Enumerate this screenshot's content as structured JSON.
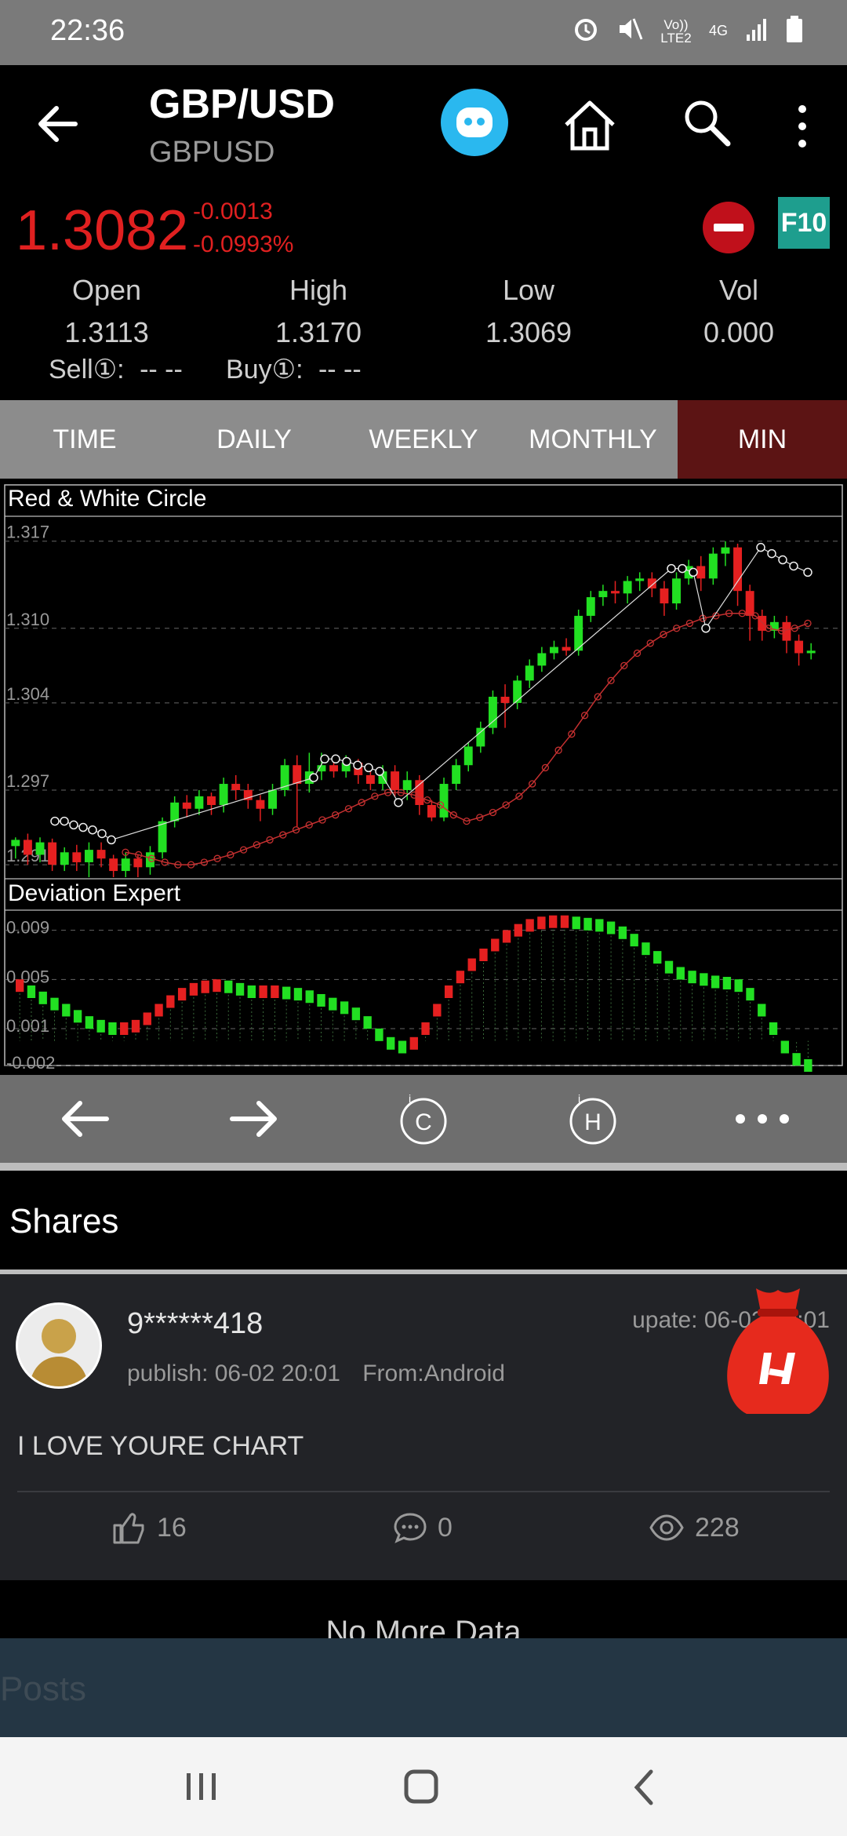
{
  "status_bar": {
    "time": "22:36",
    "network_label": "Vo)) LTE2",
    "network_type": "4G"
  },
  "header": {
    "title": "GBP/USD",
    "subtitle": "GBPUSD"
  },
  "quote": {
    "price": "1.3082",
    "change": "-0.0013",
    "change_pct": "-0.0993%",
    "f10_label": "F10",
    "stats": [
      {
        "label": "Open",
        "value": "1.3113"
      },
      {
        "label": "High",
        "value": "1.3170"
      },
      {
        "label": "Low",
        "value": "1.3069"
      },
      {
        "label": "Vol",
        "value": "0.000"
      }
    ],
    "sell_label": "Sell①:",
    "sell_value": "-- --",
    "buy_label": "Buy①:",
    "buy_value": "-- --"
  },
  "tabs": [
    {
      "label": "TIME"
    },
    {
      "label": "DAILY"
    },
    {
      "label": "WEEKLY"
    },
    {
      "label": "MONTHLY"
    },
    {
      "label": "MIN",
      "active": true
    }
  ],
  "chart_data": [
    {
      "type": "candlestick",
      "title": "Red & White Circle",
      "y_ticks": [
        "1.317",
        "1.310",
        "1.304",
        "1.297",
        "1.291"
      ],
      "ylim": [
        1.29,
        1.319
      ],
      "candles": [
        [
          1.2925,
          1.293,
          1.2915,
          1.2932
        ],
        [
          1.293,
          1.2918,
          1.291,
          1.2935
        ],
        [
          1.2918,
          1.2928,
          1.2912,
          1.2932
        ],
        [
          1.2928,
          1.291,
          1.2905,
          1.2931
        ],
        [
          1.291,
          1.292,
          1.2905,
          1.2924
        ],
        [
          1.292,
          1.2912,
          1.2905,
          1.2926
        ],
        [
          1.2912,
          1.2922,
          1.29,
          1.2928
        ],
        [
          1.2922,
          1.2915,
          1.2908,
          1.2928
        ],
        [
          1.2915,
          1.2905,
          1.29,
          1.2918
        ],
        [
          1.2905,
          1.2915,
          1.29,
          1.292
        ],
        [
          1.2915,
          1.2908,
          1.29,
          1.2918
        ],
        [
          1.2908,
          1.292,
          1.2902,
          1.2925
        ],
        [
          1.292,
          1.2945,
          1.2915,
          1.2948
        ],
        [
          1.2945,
          1.296,
          1.294,
          1.2965
        ],
        [
          1.296,
          1.2955,
          1.2948,
          1.2966
        ],
        [
          1.2955,
          1.2965,
          1.295,
          1.297
        ],
        [
          1.2965,
          1.2958,
          1.295,
          1.2968
        ],
        [
          1.2958,
          1.2975,
          1.2952,
          1.298
        ],
        [
          1.2975,
          1.297,
          1.2962,
          1.2982
        ],
        [
          1.297,
          1.2962,
          1.2955,
          1.2975
        ],
        [
          1.2962,
          1.2955,
          1.2945,
          1.2966
        ],
        [
          1.2955,
          1.297,
          1.295,
          1.2975
        ],
        [
          1.297,
          1.299,
          1.2965,
          1.2995
        ],
        [
          1.299,
          1.2975,
          1.294,
          1.2998
        ],
        [
          1.2975,
          1.2985,
          1.2968,
          1.3
        ],
        [
          1.2985,
          1.299,
          1.2978,
          1.3
        ],
        [
          1.299,
          1.2985,
          1.298,
          1.2995
        ],
        [
          1.2985,
          1.2992,
          1.298,
          1.2998
        ],
        [
          1.2992,
          1.2982,
          1.2975,
          1.2995
        ],
        [
          1.2982,
          1.2975,
          1.297,
          1.2988
        ],
        [
          1.2975,
          1.2985,
          1.297,
          1.299
        ],
        [
          1.2985,
          1.297,
          1.2965,
          1.299
        ],
        [
          1.297,
          1.2978,
          1.2962,
          1.2985
        ],
        [
          1.2978,
          1.2958,
          1.295,
          1.2982
        ],
        [
          1.2958,
          1.2948,
          1.2945,
          1.2962
        ],
        [
          1.2948,
          1.2975,
          1.2945,
          1.298
        ],
        [
          1.2975,
          1.299,
          1.297,
          1.2995
        ],
        [
          1.299,
          1.3005,
          1.2985,
          1.3008
        ],
        [
          1.3005,
          1.302,
          1.3,
          1.3025
        ],
        [
          1.302,
          1.3045,
          1.3015,
          1.305
        ],
        [
          1.3045,
          1.304,
          1.302,
          1.3055
        ],
        [
          1.304,
          1.3058,
          1.3035,
          1.3062
        ],
        [
          1.3058,
          1.307,
          1.3052,
          1.3075
        ],
        [
          1.307,
          1.308,
          1.3065,
          1.3085
        ],
        [
          1.308,
          1.3085,
          1.3075,
          1.309
        ],
        [
          1.3085,
          1.3082,
          1.3078,
          1.3092
        ],
        [
          1.3082,
          1.311,
          1.3078,
          1.3115
        ],
        [
          1.311,
          1.3125,
          1.3105,
          1.313
        ],
        [
          1.3125,
          1.313,
          1.3118,
          1.3135
        ],
        [
          1.313,
          1.3128,
          1.312,
          1.3138
        ],
        [
          1.3128,
          1.3138,
          1.312,
          1.3142
        ],
        [
          1.3138,
          1.314,
          1.313,
          1.3145
        ],
        [
          1.314,
          1.3132,
          1.3125,
          1.3145
        ],
        [
          1.3132,
          1.312,
          1.311,
          1.3138
        ],
        [
          1.312,
          1.314,
          1.3115,
          1.3145
        ],
        [
          1.314,
          1.315,
          1.3135,
          1.3155
        ],
        [
          1.315,
          1.314,
          1.313,
          1.3158
        ],
        [
          1.314,
          1.316,
          1.3135,
          1.3165
        ],
        [
          1.316,
          1.3165,
          1.315,
          1.317
        ],
        [
          1.3165,
          1.313,
          1.3118,
          1.3168
        ],
        [
          1.313,
          1.311,
          1.309,
          1.3135
        ],
        [
          1.311,
          1.3098,
          1.309,
          1.3115
        ],
        [
          1.3098,
          1.3105,
          1.3092,
          1.311
        ],
        [
          1.3105,
          1.309,
          1.308,
          1.311
        ],
        [
          1.309,
          1.308,
          1.307,
          1.3095
        ],
        [
          1.308,
          1.3082,
          1.3075,
          1.3088
        ]
      ],
      "series": [
        {
          "type": "circle-line",
          "color": "#cc3333",
          "values": [
            1.292,
            1.2918,
            1.2915,
            1.2912,
            1.291,
            1.291,
            1.2912,
            1.2915,
            1.2918,
            1.2922,
            1.2926,
            1.293,
            1.2934,
            1.2938,
            1.2942,
            1.2946,
            1.295,
            1.2955,
            1.296,
            1.2965,
            1.2968,
            1.2968,
            1.2966,
            1.2962,
            1.2958,
            1.295,
            1.2945,
            1.2948,
            1.2952,
            1.2958,
            1.2965,
            1.2975,
            1.2988,
            1.3002,
            1.3015,
            1.303,
            1.3045,
            1.3058,
            1.307,
            1.308,
            1.3088,
            1.3095,
            1.31,
            1.3104,
            1.3108,
            1.311,
            1.3112,
            1.3112,
            1.311,
            1.31,
            1.3098,
            1.31,
            1.3104
          ]
        },
        {
          "type": "white-circle",
          "color": "#ffffff",
          "values": [
            1.2945,
            1.2945,
            1.2942,
            1.294,
            1.2938,
            1.2935,
            1.293,
            1.298,
            1.2995,
            1.2995,
            1.2993,
            1.299,
            1.2988,
            1.2985,
            1.296,
            1.3148,
            1.3148,
            1.3145,
            1.31,
            1.3165,
            1.316,
            1.3155,
            1.315,
            1.3145
          ]
        }
      ]
    },
    {
      "type": "bar",
      "title": "Deviation Expert",
      "y_ticks": [
        "0.009",
        "0.005",
        "0.001",
        "-0.002"
      ],
      "ylim": [
        -0.002,
        0.01
      ],
      "values": [
        0.0045,
        0.004,
        0.0035,
        0.003,
        0.0025,
        0.002,
        0.0015,
        0.0012,
        0.001,
        0.001,
        0.0012,
        0.0018,
        0.0025,
        0.0032,
        0.0038,
        0.0042,
        0.0044,
        0.0045,
        0.0044,
        0.0042,
        0.004,
        0.004,
        0.004,
        0.0039,
        0.0038,
        0.0036,
        0.0033,
        0.003,
        0.0027,
        0.0022,
        0.0015,
        0.0005,
        -0.0002,
        -0.0005,
        -0.0002,
        0.001,
        0.0025,
        0.004,
        0.0052,
        0.0062,
        0.007,
        0.0078,
        0.0085,
        0.009,
        0.0094,
        0.0096,
        0.0097,
        0.0097,
        0.0096,
        0.0095,
        0.0094,
        0.0092,
        0.0088,
        0.0082,
        0.0075,
        0.0068,
        0.006,
        0.0055,
        0.0052,
        0.005,
        0.0048,
        0.0047,
        0.0045,
        0.0038,
        0.0025,
        0.001,
        -0.0005,
        -0.0015,
        -0.002
      ],
      "colors_rule": "green when falling, red when rising"
    }
  ],
  "toolbar": {
    "items": [
      "back-arrow",
      "forward-arrow",
      "c-indicator",
      "h-indicator",
      "more-dots"
    ]
  },
  "shares": {
    "title": "Shares",
    "post": {
      "user": "9******418",
      "publish": "publish: 06-02 20:01",
      "from": "From:Android",
      "update": "upate: 06-02 20:01",
      "text": "I LOVE YOURE CHART",
      "likes": "16",
      "comments": "0",
      "views": "228"
    },
    "no_more": "No More Data"
  },
  "posts_input": {
    "placeholder": "Posts"
  }
}
